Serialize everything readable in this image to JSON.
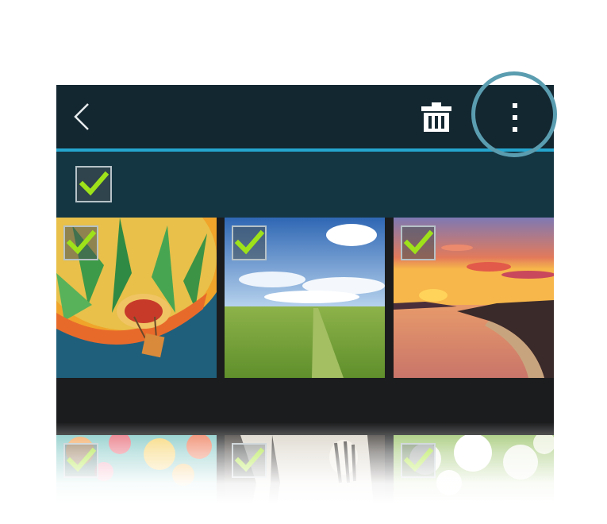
{
  "toolbar": {
    "back_icon": "chevron-left-icon",
    "delete_icon": "trash-icon",
    "overflow_icon": "more-vertical-icon"
  },
  "select_all": {
    "checked": true,
    "icon": "checkmark-icon"
  },
  "photos": [
    {
      "subject": "hot-air-balloon",
      "checked": true
    },
    {
      "subject": "wheat-field-sky",
      "checked": true
    },
    {
      "subject": "sunset-coast",
      "checked": true
    },
    {
      "subject": "colorful-bokeh",
      "checked": true
    },
    {
      "subject": "zebras",
      "checked": true
    },
    {
      "subject": "white-flowers",
      "checked": true
    }
  ],
  "colors": {
    "actionbar": "#132731",
    "accent_rule": "#25a6cf",
    "selectbar": "#143643",
    "check": "#9ee21a",
    "highlight_ring": "#5b9db0"
  }
}
